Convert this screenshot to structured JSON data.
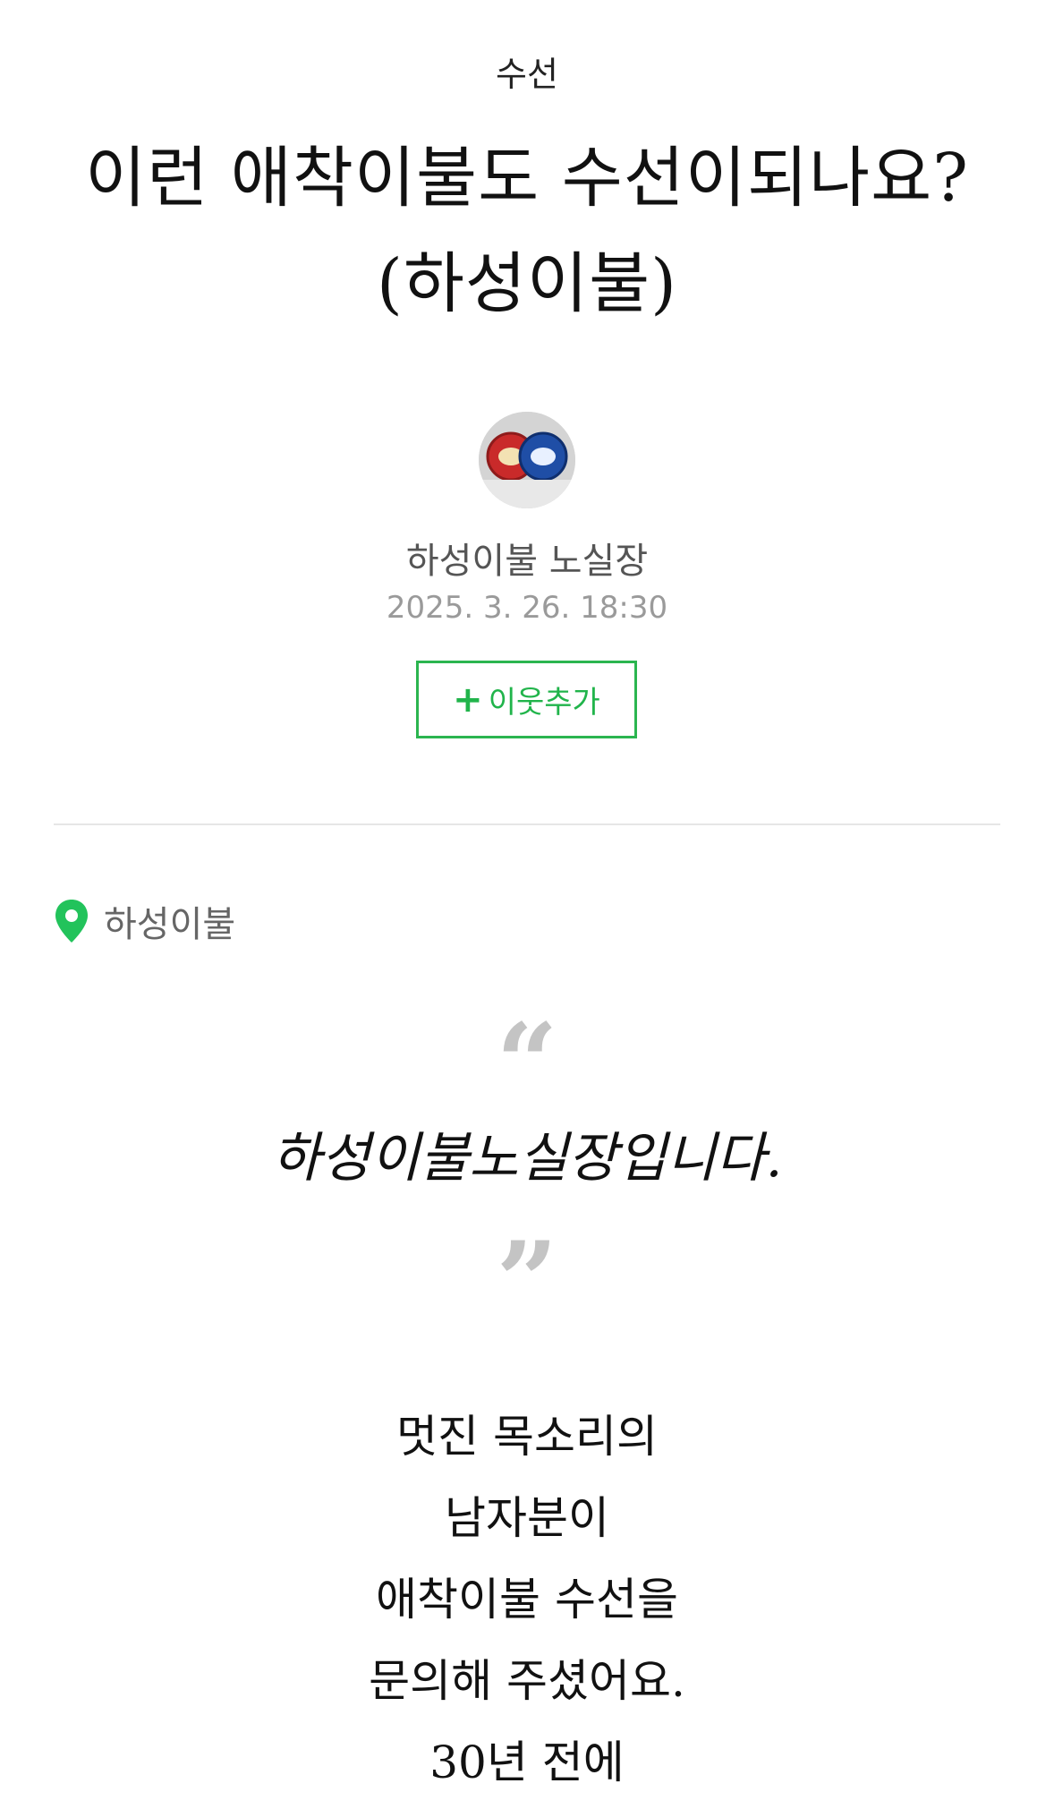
{
  "post": {
    "category": "수선",
    "title_line1": "이런 애착이불도 수선이되나요?",
    "title_line2": "(하성이불)"
  },
  "author": {
    "name": "하성이불 노실장",
    "date": "2025. 3. 26. 18:30",
    "avatar_icon": "avatar-photo-icon"
  },
  "neighbor_button": {
    "plus": "+",
    "label": "이웃추가",
    "color": "#21b44b"
  },
  "place": {
    "icon": "map-pin-icon",
    "label": "하성이불",
    "color": "#22c35b"
  },
  "quote": {
    "open_mark": "“",
    "text": "하성이불노실장입니다.",
    "close_mark": "”"
  },
  "body": {
    "lines": [
      "멋진 목소리의",
      "남자분이",
      "애착이불 수선을",
      "문의해 주셨어요.",
      "30년 전에"
    ]
  }
}
